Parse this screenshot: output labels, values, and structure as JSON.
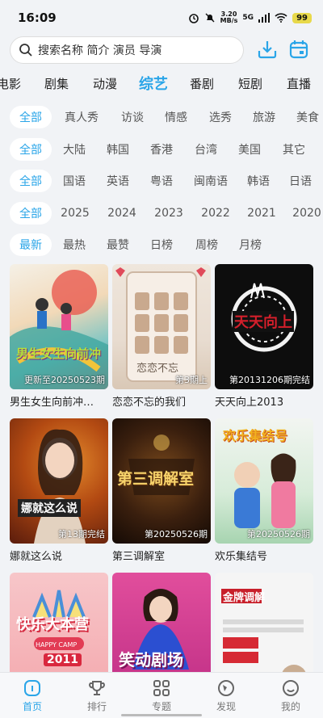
{
  "status": {
    "time": "16:09",
    "net_speed": "3.20",
    "net_unit": "MB/s",
    "signal": "5G",
    "battery": "99"
  },
  "search": {
    "placeholder": "搜索名称 简介 演员 导演"
  },
  "icons": {
    "download": "download-icon",
    "calendar": "calendar-icon"
  },
  "accent": "#2aa5e8",
  "categories": [
    "电影",
    "剧集",
    "动漫",
    "综艺",
    "番剧",
    "短剧",
    "直播"
  ],
  "filters": {
    "type": [
      "全部",
      "真人秀",
      "访谈",
      "情感",
      "选秀",
      "旅游",
      "美食"
    ],
    "region": [
      "全部",
      "大陆",
      "韩国",
      "香港",
      "台湾",
      "美国",
      "其它"
    ],
    "language": [
      "全部",
      "国语",
      "英语",
      "粤语",
      "闽南语",
      "韩语",
      "日语"
    ],
    "year": [
      "全部",
      "2025",
      "2024",
      "2023",
      "2022",
      "2021",
      "2020"
    ],
    "sort": [
      "最新",
      "最热",
      "最赞",
      "日榜",
      "周榜",
      "月榜"
    ]
  },
  "shows": [
    {
      "name": "男生女生向前冲…",
      "badge": "更新至20250523期",
      "poster_text": "男生女生向前冲"
    },
    {
      "name": "恋恋不忘的我们",
      "badge": "第3期上",
      "poster_text": "恋恋不忘"
    },
    {
      "name": "天天向上2013",
      "badge": "第20131206期完结",
      "poster_text": "天天向上"
    },
    {
      "name": "娜就这么说",
      "badge": "第13期完结",
      "poster_text": "娜就这么说"
    },
    {
      "name": "第三调解室",
      "badge": "第20250526期",
      "poster_text": "第三调解室"
    },
    {
      "name": "欢乐集结号",
      "badge": "第20250526期",
      "poster_text": "欢乐集结号"
    },
    {
      "name": "",
      "badge": "",
      "poster_text": "快乐大本营"
    },
    {
      "name": "",
      "badge": "",
      "poster_text": "笑动剧场"
    },
    {
      "name": "",
      "badge": "",
      "poster_text": "金牌调解"
    }
  ],
  "poster_extra": {
    "hc_banner": "HAPPY CAMP",
    "hc_year": "2011"
  },
  "nav": [
    {
      "label": "首页",
      "icon": "home-icon"
    },
    {
      "label": "排行",
      "icon": "trophy-icon"
    },
    {
      "label": "专题",
      "icon": "grid-icon"
    },
    {
      "label": "发现",
      "icon": "compass-icon"
    },
    {
      "label": "我的",
      "icon": "smile-icon"
    }
  ]
}
